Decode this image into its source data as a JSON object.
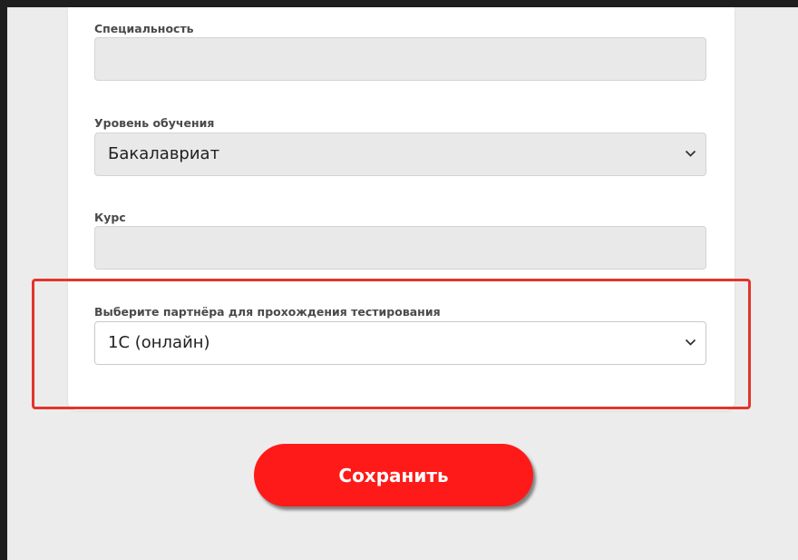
{
  "form": {
    "specialty": {
      "label": "Специальность",
      "value": ""
    },
    "education_level": {
      "label": "Уровень обучения",
      "selected": "Бакалавриат"
    },
    "course": {
      "label": "Курс",
      "value": ""
    },
    "partner": {
      "label": "Выберите партнёра для прохождения тестирования",
      "selected": "1С (онлайн)"
    }
  },
  "actions": {
    "save_label": "Сохранить"
  },
  "colors": {
    "accent": "#ff1a1a",
    "highlight_border": "#e2352b",
    "page_background": "#ececec",
    "frame": "#1f1f1f"
  },
  "icons": {
    "select_arrow": "chevron-down-icon"
  }
}
